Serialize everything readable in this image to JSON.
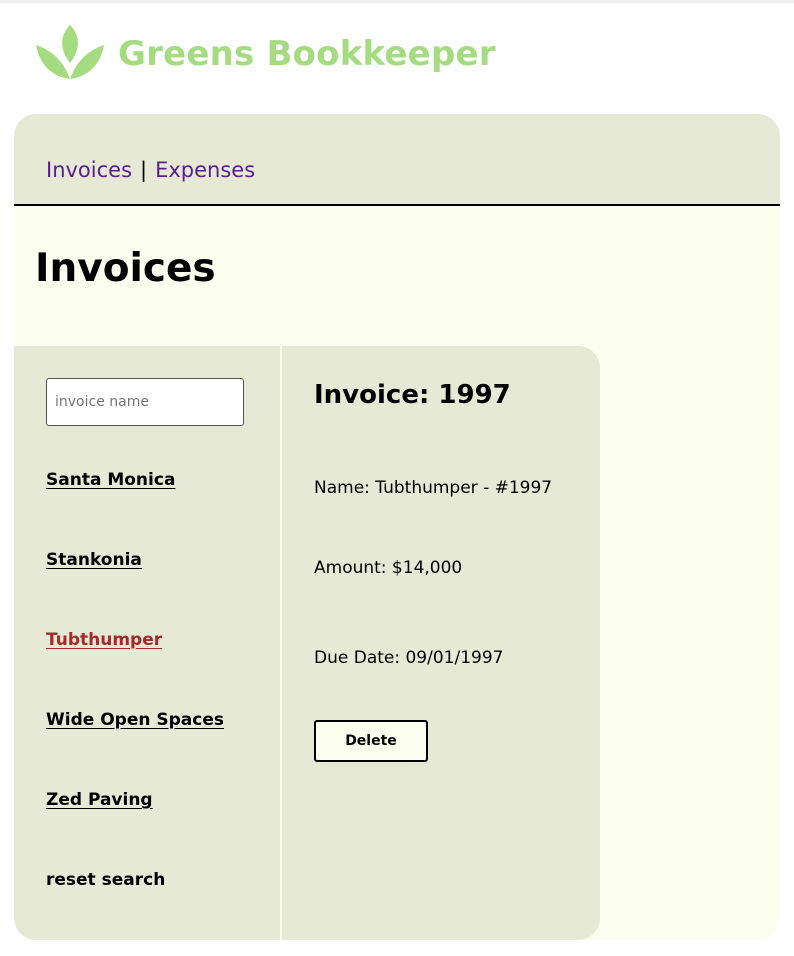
{
  "brand": {
    "name": "Greens Bookkeeper",
    "logo_icon": "leaf-logo-icon",
    "color": "#a6dc81"
  },
  "nav": {
    "links": [
      "Invoices",
      "Expenses"
    ],
    "separator": "|",
    "link_color": "#5a1e8c"
  },
  "page": {
    "title": "Invoices"
  },
  "search": {
    "placeholder": "invoice name",
    "value": ""
  },
  "invoices": [
    {
      "name": "Santa Monica",
      "active": false
    },
    {
      "name": "Stankonia",
      "active": false
    },
    {
      "name": "Tubthumper",
      "active": true
    },
    {
      "name": "Wide Open Spaces",
      "active": false
    },
    {
      "name": "Zed Paving",
      "active": false
    }
  ],
  "reset_label": "reset search",
  "detail": {
    "title": "Invoice: 1997",
    "name_line": "Name: Tubthumper - #1997",
    "amount_line": "Amount: $14,000",
    "due_line": "Due Date: 09/01/1997",
    "delete_label": "Delete"
  },
  "colors": {
    "panel": "#e6e9d6",
    "background": "#fcfeef",
    "active_link": "#a52a2a"
  }
}
